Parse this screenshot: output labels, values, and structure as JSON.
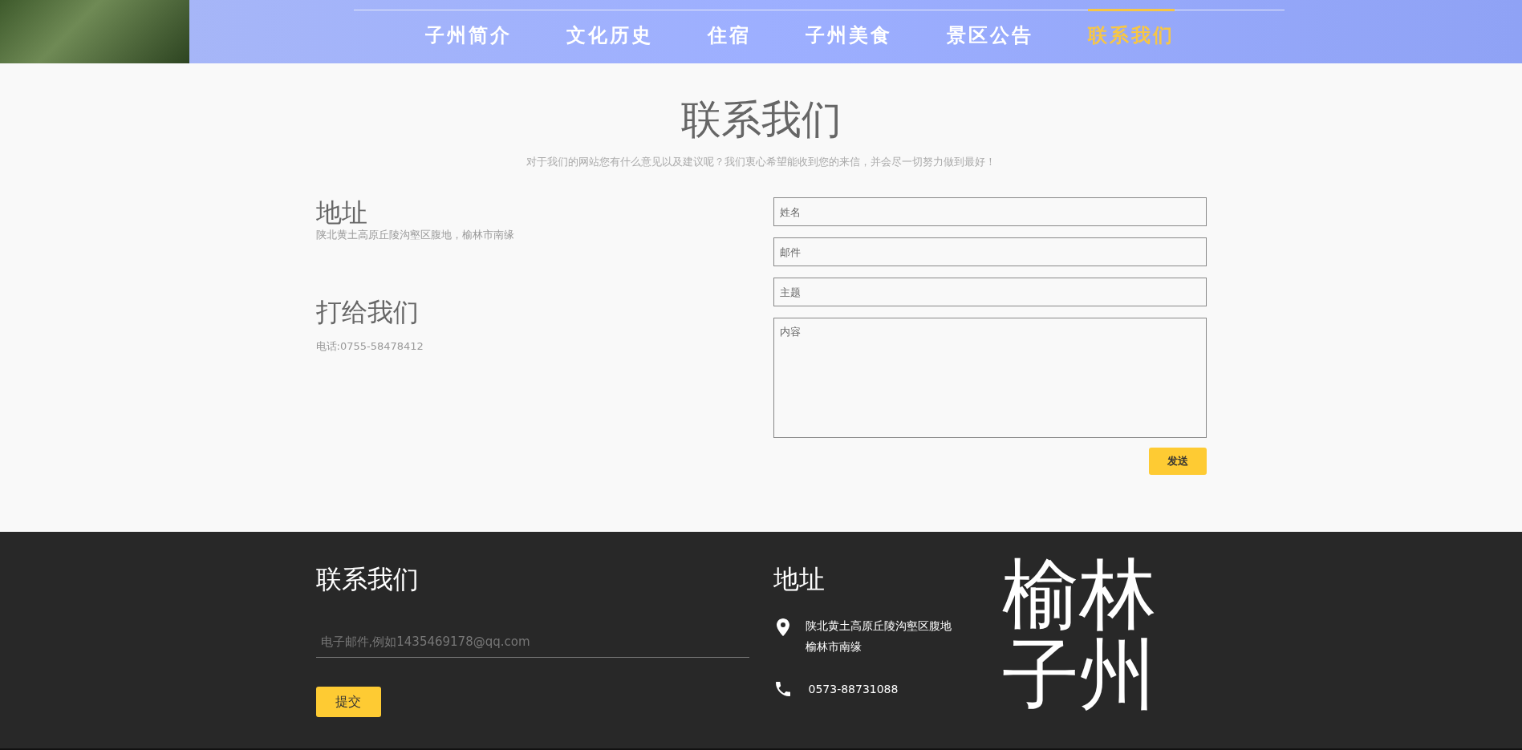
{
  "nav": [
    {
      "label": "子州简介",
      "selected": false
    },
    {
      "label": "文化历史",
      "selected": false
    },
    {
      "label": "住宿",
      "selected": false
    },
    {
      "label": "子州美食",
      "selected": false
    },
    {
      "label": "景区公告",
      "selected": false
    },
    {
      "label": "联系我们",
      "selected": true
    }
  ],
  "contact": {
    "title": "联系我们",
    "subtitle": "对于我们的网站您有什么意见以及建议呢？我们衷心希望能收到您的来信，并会尽一切努力做到最好！",
    "address": {
      "heading": "地址",
      "text": "陕北黄土高原丘陵沟壑区腹地，榆林市南缘"
    },
    "phone": {
      "heading": "打给我们",
      "text": "电话:0755-58478412"
    },
    "form": {
      "fields": [
        {
          "placeholder": "姓名",
          "kind": "input"
        },
        {
          "placeholder": "邮件",
          "kind": "input"
        },
        {
          "placeholder": "主题",
          "kind": "input"
        },
        {
          "placeholder": "内容",
          "kind": "textarea"
        }
      ],
      "button": "发送"
    }
  },
  "footer": {
    "contact": {
      "heading": "联系我们",
      "placeholder": "电子邮件,例如1435469178@qq.com",
      "button": "提交"
    },
    "address": {
      "heading": "地址",
      "lines": [
        "陕北黄土高原丘陵沟壑区腹地",
        "榆林市南缘"
      ],
      "phone": "0573-88731088"
    },
    "logo": [
      "榆林",
      "子州"
    ]
  }
}
